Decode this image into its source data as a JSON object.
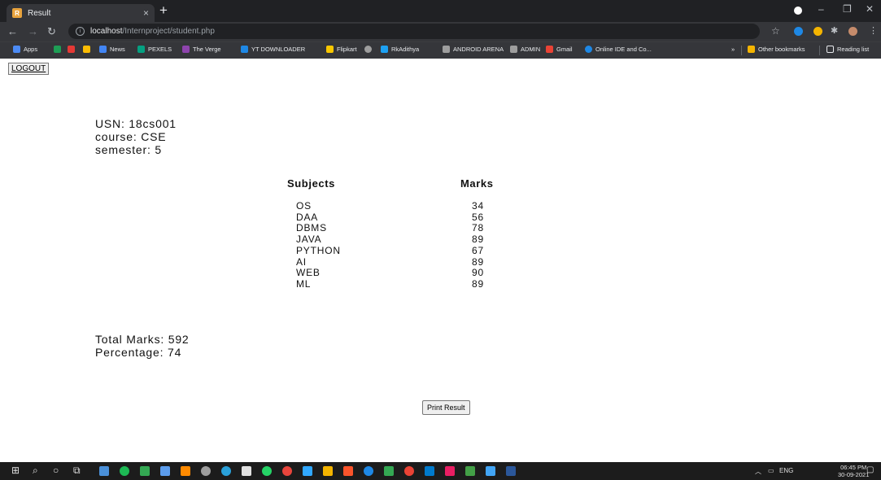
{
  "browser": {
    "tab_title": "Result",
    "tab_close": "×",
    "new_tab": "+",
    "url_host": "localhost",
    "url_path": "/Internproject/student.php",
    "bookmarks": [
      {
        "label": "Apps",
        "color": "#4c8bf5"
      },
      {
        "label": "",
        "color": "#1e9e55"
      },
      {
        "label": "",
        "color": "#e53935"
      },
      {
        "label": "",
        "color": "#fbbc04"
      },
      {
        "label": "News",
        "color": "#4285f4"
      },
      {
        "label": "PEXELS",
        "color": "#05a081"
      },
      {
        "label": "The Verge",
        "color": "#8e44ad"
      },
      {
        "label": "YT DOWNLOADER",
        "color": "#1e88e5"
      },
      {
        "label": "Flipkart",
        "color": "#f9c700"
      },
      {
        "label": "",
        "color": "#9e9e9e"
      },
      {
        "label": "RkAdithya",
        "color": "#1da1f2"
      },
      {
        "label": "ANDROID ARENA",
        "color": "#9e9e9e"
      },
      {
        "label": "ADMIN",
        "color": "#9e9e9e"
      },
      {
        "label": "Gmail",
        "color": "#ea4335"
      },
      {
        "label": "Online IDE and Co...",
        "color": "#1e88e5"
      }
    ],
    "more_bookmarks": "»",
    "other_bookmarks": "Other bookmarks",
    "reading_list": "Reading list"
  },
  "page": {
    "logout_label": "LOGOUT",
    "usn": "USN: 18cs001",
    "course": "course: CSE",
    "semester": "semester: 5",
    "subjects_header": "Subjects",
    "marks_header": "Marks",
    "rows": [
      {
        "subject": "OS",
        "marks": "34"
      },
      {
        "subject": "DAA",
        "marks": "56"
      },
      {
        "subject": "DBMS",
        "marks": "78"
      },
      {
        "subject": "JAVA",
        "marks": "89"
      },
      {
        "subject": "PYTHON",
        "marks": "67"
      },
      {
        "subject": "AI",
        "marks": "89"
      },
      {
        "subject": "WEB",
        "marks": "90"
      },
      {
        "subject": "ML",
        "marks": "89"
      }
    ],
    "total_marks": "Total Marks: 592",
    "percentage": "Percentage: 74",
    "print_label": "Print Result"
  },
  "taskbar": {
    "tray_lang": "ENG",
    "time": "06:45 PM",
    "date": "30-09-2021"
  }
}
